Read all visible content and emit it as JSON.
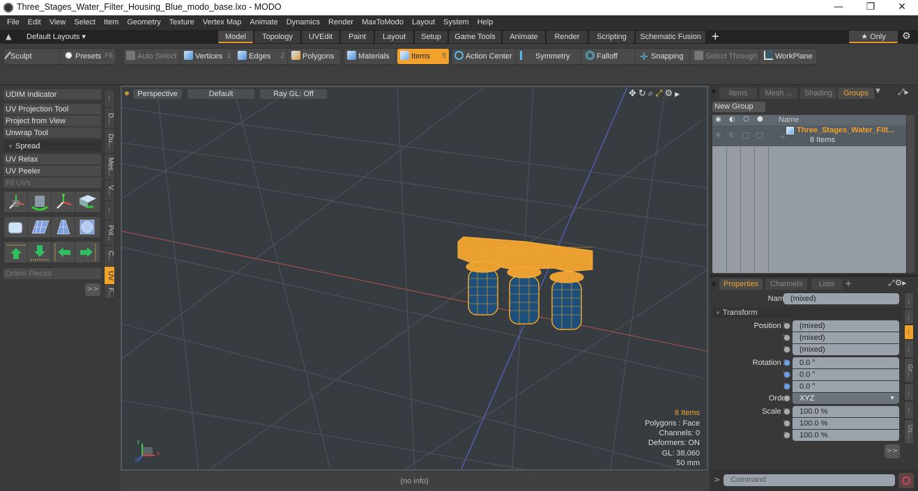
{
  "window": {
    "title": "Three_Stages_Water_Filter_Housing_Blue_modo_base.lxo - MODO",
    "controls": {
      "minimize": "—",
      "maximize": "❐",
      "close": "✕"
    }
  },
  "menu": [
    "File",
    "Edit",
    "View",
    "Select",
    "Item",
    "Geometry",
    "Texture",
    "Vertex Map",
    "Animate",
    "Dynamics",
    "Render",
    "MaxToModo",
    "Layout",
    "System",
    "Help"
  ],
  "layoutbar": {
    "layouts_label": "Default Layouts ▾",
    "tabs": [
      "Model",
      "Topology",
      "UVEdit",
      "Paint",
      "Layout",
      "Setup",
      "Game Tools",
      "Animate",
      "Render",
      "Scripting",
      "Schematic Fusion"
    ],
    "active_tab": "Model",
    "add": "+",
    "only_label": "★ Only"
  },
  "toolbar": {
    "sculpt": "Sculpt",
    "presets": "Presets",
    "presets_key": "F6",
    "auto_select": "Auto Select",
    "vertices": "Vertices",
    "vertices_key": "1",
    "edges": "Edges",
    "edges_key": "2",
    "polygons": "Polygons",
    "materials": "Materials",
    "items": "Items",
    "items_key": "5",
    "action_center": "Action Center",
    "symmetry": "Symmetry",
    "falloff": "Falloff",
    "snapping": "Snapping",
    "select_through": "Select Through",
    "workplane": "WorkPlane"
  },
  "leftpanel": {
    "udim": "UDIM Indicator",
    "uv_projection": "UV Projection Tool",
    "project_from_view": "Project from View",
    "unwrap": "Unwrap Tool",
    "spread": "Spread",
    "uv_relax": "UV Relax",
    "uv_peeler": "UV Peeler",
    "fit_uvs": "Fit UVs",
    "orient_pieces": "Orient Pieces",
    "more": ">>",
    "vtabs": [
      "...",
      "D...",
      "Du...",
      "Mes...",
      "V...",
      "...",
      "Pol...",
      "C...",
      "UV",
      "F..."
    ],
    "active_vtab": "UV"
  },
  "viewport": {
    "view": "Perspective",
    "shading": "Default",
    "raygl": "Ray GL: Off",
    "info": {
      "items": "8 Items",
      "polygons": "Polygons : Face",
      "channels": "Channels: 0",
      "deformers": "Deformers: ON",
      "gl": "GL: 38,060",
      "scale": "50 mm"
    },
    "axis": {
      "x": "X",
      "y": "Y",
      "z": "Z"
    }
  },
  "status": {
    "text": "(no info)"
  },
  "groups_panel": {
    "tabs": [
      "Items",
      "Mesh ...",
      "Shading",
      "Groups"
    ],
    "active_tab": "Groups",
    "new_group": "New Group",
    "column_name": "Name",
    "group": {
      "name": "Three_Stages_Water_Filt...",
      "count": "8 Items"
    }
  },
  "properties_panel": {
    "tabs": [
      "Properties",
      "Channels",
      "Lists"
    ],
    "active_tab": "Properties",
    "add": "+",
    "name_label": "Name",
    "name_value": "(mixed)",
    "section": "Transform",
    "position": {
      "label": "Position X",
      "x": "(mixed)",
      "y": "(mixed)",
      "z": "(mixed)"
    },
    "rotation": {
      "label": "Rotation X",
      "x": "0.0 °",
      "y": "0.0 °",
      "z": "0.0 °"
    },
    "order": {
      "label": "Order",
      "value": "XYZ"
    },
    "scale": {
      "label": "Scale X",
      "x": "100.0 %",
      "y": "100.0 %",
      "z": "100.0 %"
    },
    "axis_y": "Y",
    "axis_z": "Z",
    "more": ">>",
    "vtabs": [
      "...",
      "...",
      "...",
      "...",
      "Gr...",
      "...",
      "...",
      "Us..."
    ]
  },
  "command": {
    "prompt": ">",
    "placeholder": "Command"
  },
  "colors": {
    "accent": "#f0a22c",
    "viewport_bg": "#373c41",
    "selection": "#f5a623",
    "mesh_fill": "#1d4f7a"
  }
}
